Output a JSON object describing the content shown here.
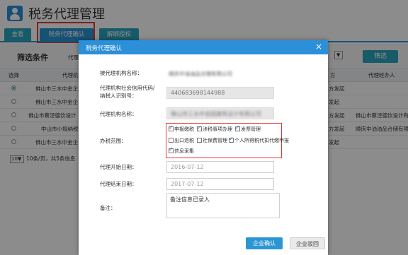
{
  "page": {
    "title": "税务代理管理",
    "tabs": [
      {
        "label": "查看"
      },
      {
        "label": "税务代理确认"
      },
      {
        "label": "解绑授权"
      }
    ]
  },
  "filter": {
    "title": "筛选条件",
    "agency_label": "代理",
    "select_arrow": "▼",
    "filter_button": "筛选"
  },
  "grid": {
    "headers": [
      "选择",
      "代理机",
      "方",
      "代理经办人"
    ],
    "rows": [
      {
        "selected": true,
        "org": "佛山市三水中金企业",
        "party": "方发起",
        "agent": ""
      },
      {
        "selected": false,
        "org": "佛山市三水中金企",
        "party": "发起",
        "agent": ""
      },
      {
        "selected": false,
        "org": "佛山市蔡泾德饮设计",
        "party": "方发起",
        "agent": "佛山市蔡泾德饮设计有"
      },
      {
        "selected": false,
        "org": "中山市小规纳税B",
        "party": "方发起",
        "agent": "顺庆中油油品合储有限"
      },
      {
        "selected": false,
        "org": "佛山市三水中金企",
        "party": "发起",
        "agent": ""
      }
    ],
    "pager": {
      "page_size": "10",
      "page_size_arrow": "▼",
      "summary": "10条/页，共5条信息"
    }
  },
  "modal": {
    "title": "税务代理确认",
    "close_glyph": "×",
    "fields": {
      "agent_org_label": "被代理机构名称：",
      "agent_org_value": "顺庆中油油品合储有限公司",
      "credit_code_label_1": "代理机构社会信用代码/",
      "credit_code_label_2": "纳税人识别号：",
      "credit_code_value": "440683698144988",
      "proxy_name_label": "代理机构名称：",
      "proxy_name_value": "佛山市三水中金园建筑设计有限公司",
      "scope_label": "办税范围：",
      "start_label": "代理开始日期：",
      "start_value": "2016-07-12",
      "end_label": "代理结束日期：",
      "end_value": "2017-07-12",
      "remark_label": "备注：",
      "remark_value": "备注信息已录入"
    },
    "scope_options": [
      {
        "label": "申报缴税",
        "checked": true
      },
      {
        "label": "涉税事项办理",
        "checked": true
      },
      {
        "label": "发票管理",
        "checked": true
      },
      {
        "label": "出口退税",
        "checked": false
      },
      {
        "label": "社保费管理",
        "checked": false
      },
      {
        "label": "个人所得税代扣代缴申报",
        "checked": true
      },
      {
        "label": "信息采集",
        "checked": true
      }
    ],
    "buttons": {
      "confirm": "企业确认",
      "reject": "企业驳回"
    }
  },
  "colors": {
    "accent": "#2b96d4",
    "header": "#2b8fd9",
    "tab": "#2ba7c0",
    "highlight": "#e53935"
  }
}
